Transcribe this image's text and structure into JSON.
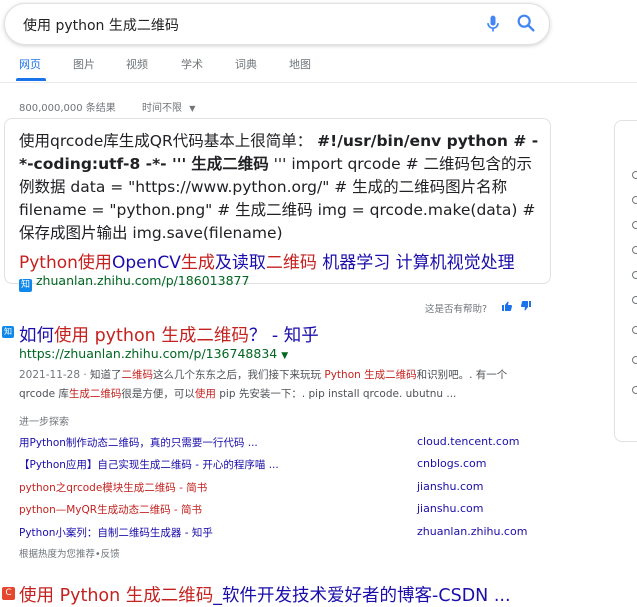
{
  "search": {
    "query": "使用 python 生成二维码"
  },
  "tabs": [
    {
      "label": "网页",
      "active": true
    },
    {
      "label": "图片",
      "active": false
    },
    {
      "label": "视频",
      "active": false
    },
    {
      "label": "学术",
      "active": false
    },
    {
      "label": "词典",
      "active": false
    },
    {
      "label": "地图",
      "active": false
    }
  ],
  "stats": {
    "result_count": "800,000,000 条结果",
    "time_filter": "时间不限"
  },
  "featured_snippet": {
    "text_1": "使用qrcode库生成QR代码基本上很简单：",
    "text_2": "#!/usr/bin/env python # -*-coding:utf-8 -*- '''",
    "text_3": "生成二维码",
    "text_4": "''' import qrcode # 二维码包含的示例数据 data = \"https://www.python.org/\" # 生成的二维码图片名称 filename = \"python.png\" # 生成二维码 img = qrcode.make(data) # 保存成图片输出 img.save(filename)",
    "title_parts": [
      {
        "text": "Python使用",
        "hl": true
      },
      {
        "text": "OpenCV",
        "hl": false
      },
      {
        "text": "生成",
        "hl": true
      },
      {
        "text": "及读取",
        "hl": false
      },
      {
        "text": "二维码",
        "hl": true
      },
      {
        "text": " 机器学习 计算机视觉处理",
        "hl": false
      }
    ],
    "favicon": "知",
    "url": "zhuanlan.zhihu.com/p/186013877"
  },
  "feedback": {
    "label": "这是否有帮助?"
  },
  "result_1": {
    "favicon": "知",
    "title_parts": [
      {
        "text": "如何",
        "hl": false
      },
      {
        "text": "使用 python 生成二维码",
        "hl": true
      },
      {
        "text": "？ - 知乎",
        "hl": false
      }
    ],
    "url": "https://zhuanlan.zhihu.com/p/136748834",
    "date": "2021-11-28 ·",
    "desc_parts": [
      {
        "text": " 知道了",
        "hl": false
      },
      {
        "text": "二维码",
        "hl": true
      },
      {
        "text": "这么几个东东之后，我们接下来玩玩 ",
        "hl": false
      },
      {
        "text": "Python 生成二维码",
        "hl": true
      },
      {
        "text": "和识别吧。. 有一个 qrcode 库",
        "hl": false
      },
      {
        "text": "生成二维码",
        "hl": true
      },
      {
        "text": "很是方便，可以",
        "hl": false
      },
      {
        "text": "使用",
        "hl": true
      },
      {
        "text": " pip 先安装一下：. pip install qrcode. ubutnu ...",
        "hl": false
      }
    ]
  },
  "explore": {
    "heading": "进一步探索",
    "items": [
      {
        "text": "用Python制作动态二维码，真的只需要一行代码 ...",
        "domain": "cloud.tencent.com",
        "visited": false
      },
      {
        "text": "【Python应用】自己实现生成二维码 - 开心的程序喵 ...",
        "domain": "cnblogs.com",
        "visited": false
      },
      {
        "text": "python之qrcode模块生成二维码 - 简书",
        "domain": "jianshu.com",
        "visited": true
      },
      {
        "text": "python—MyQR生成动态二维码 - 简书",
        "domain": "jianshu.com",
        "visited": true
      },
      {
        "text": "Python小案列：自制二维码生成器 - 知乎",
        "domain": "zhuanlan.zhihu.com",
        "visited": false
      }
    ],
    "footer": "根据热度为您推荐•反馈"
  },
  "result_2": {
    "favicon": "C",
    "title_parts": [
      {
        "text": "使用 Python 生成二维码",
        "hl": true
      },
      {
        "text": "_软件开发技术爱好者的博客-CSDN ...",
        "hl": false
      }
    ]
  },
  "colors": {
    "link": "#1a0dab",
    "highlight": "#c5221f",
    "url_green": "#006621",
    "accent_blue": "#1a73e8"
  }
}
